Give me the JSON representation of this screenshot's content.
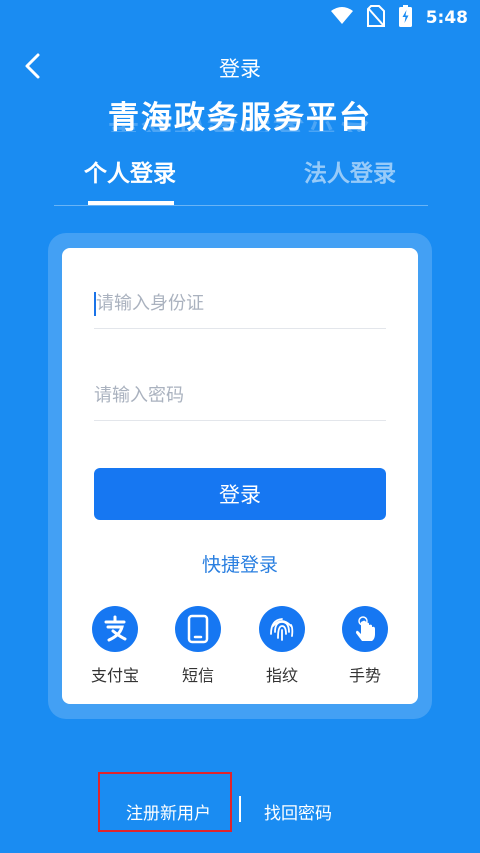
{
  "status_bar": {
    "time": "5:48",
    "icons": [
      "wifi-icon",
      "no-sim-icon",
      "battery-charging-icon"
    ]
  },
  "header": {
    "title": "登录",
    "back_icon": "chevron-left-icon"
  },
  "platform_title": "青海政务服务平台",
  "tabs": [
    {
      "label": "个人登录",
      "active": true
    },
    {
      "label": "法人登录",
      "active": false
    }
  ],
  "form": {
    "id_placeholder": "请输入身份证",
    "password_placeholder": "请输入密码",
    "login_label": "登录"
  },
  "quick_login": {
    "label": "快捷登录",
    "methods": [
      {
        "label": "支付宝",
        "icon": "alipay-icon"
      },
      {
        "label": "短信",
        "icon": "phone-icon"
      },
      {
        "label": "指纹",
        "icon": "fingerprint-icon"
      },
      {
        "label": "手势",
        "icon": "gesture-hand-icon"
      }
    ]
  },
  "bottom_links": {
    "register": "注册新用户",
    "recover": "找回密码"
  },
  "colors": {
    "background": "#1a8cf2",
    "primary_button": "#1677f2",
    "link": "#2a7fe0",
    "highlight_box": "#e0242b"
  }
}
